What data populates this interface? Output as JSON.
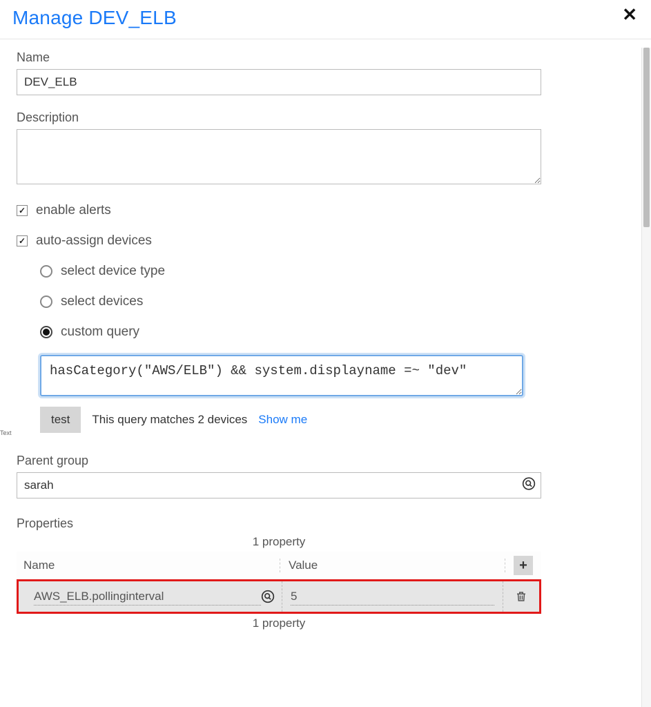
{
  "header": {
    "title": "Manage DEV_ELB"
  },
  "fields": {
    "name_label": "Name",
    "name_value": "DEV_ELB",
    "description_label": "Description",
    "description_value": ""
  },
  "checkboxes": {
    "enable_alerts_label": "enable alerts",
    "enable_alerts_checked": true,
    "auto_assign_label": "auto-assign devices",
    "auto_assign_checked": true
  },
  "radios": {
    "device_type_label": "select device type",
    "devices_label": "select devices",
    "custom_query_label": "custom query",
    "selected": "custom_query"
  },
  "query": {
    "text": "hasCategory(\"AWS/ELB\") && system.displayname =~ \"dev\"",
    "test_button": "test",
    "result_text": "This query matches 2 devices",
    "show_me": "Show me"
  },
  "parent_group": {
    "label": "Parent group",
    "value": "sarah"
  },
  "properties": {
    "section_label": "Properties",
    "count_label_top": "1 property",
    "count_label_bottom": "1 property",
    "col_name": "Name",
    "col_value": "Value",
    "rows": [
      {
        "name": "AWS_ELB.pollinginterval",
        "value": "5"
      }
    ]
  },
  "side_label": "Text"
}
